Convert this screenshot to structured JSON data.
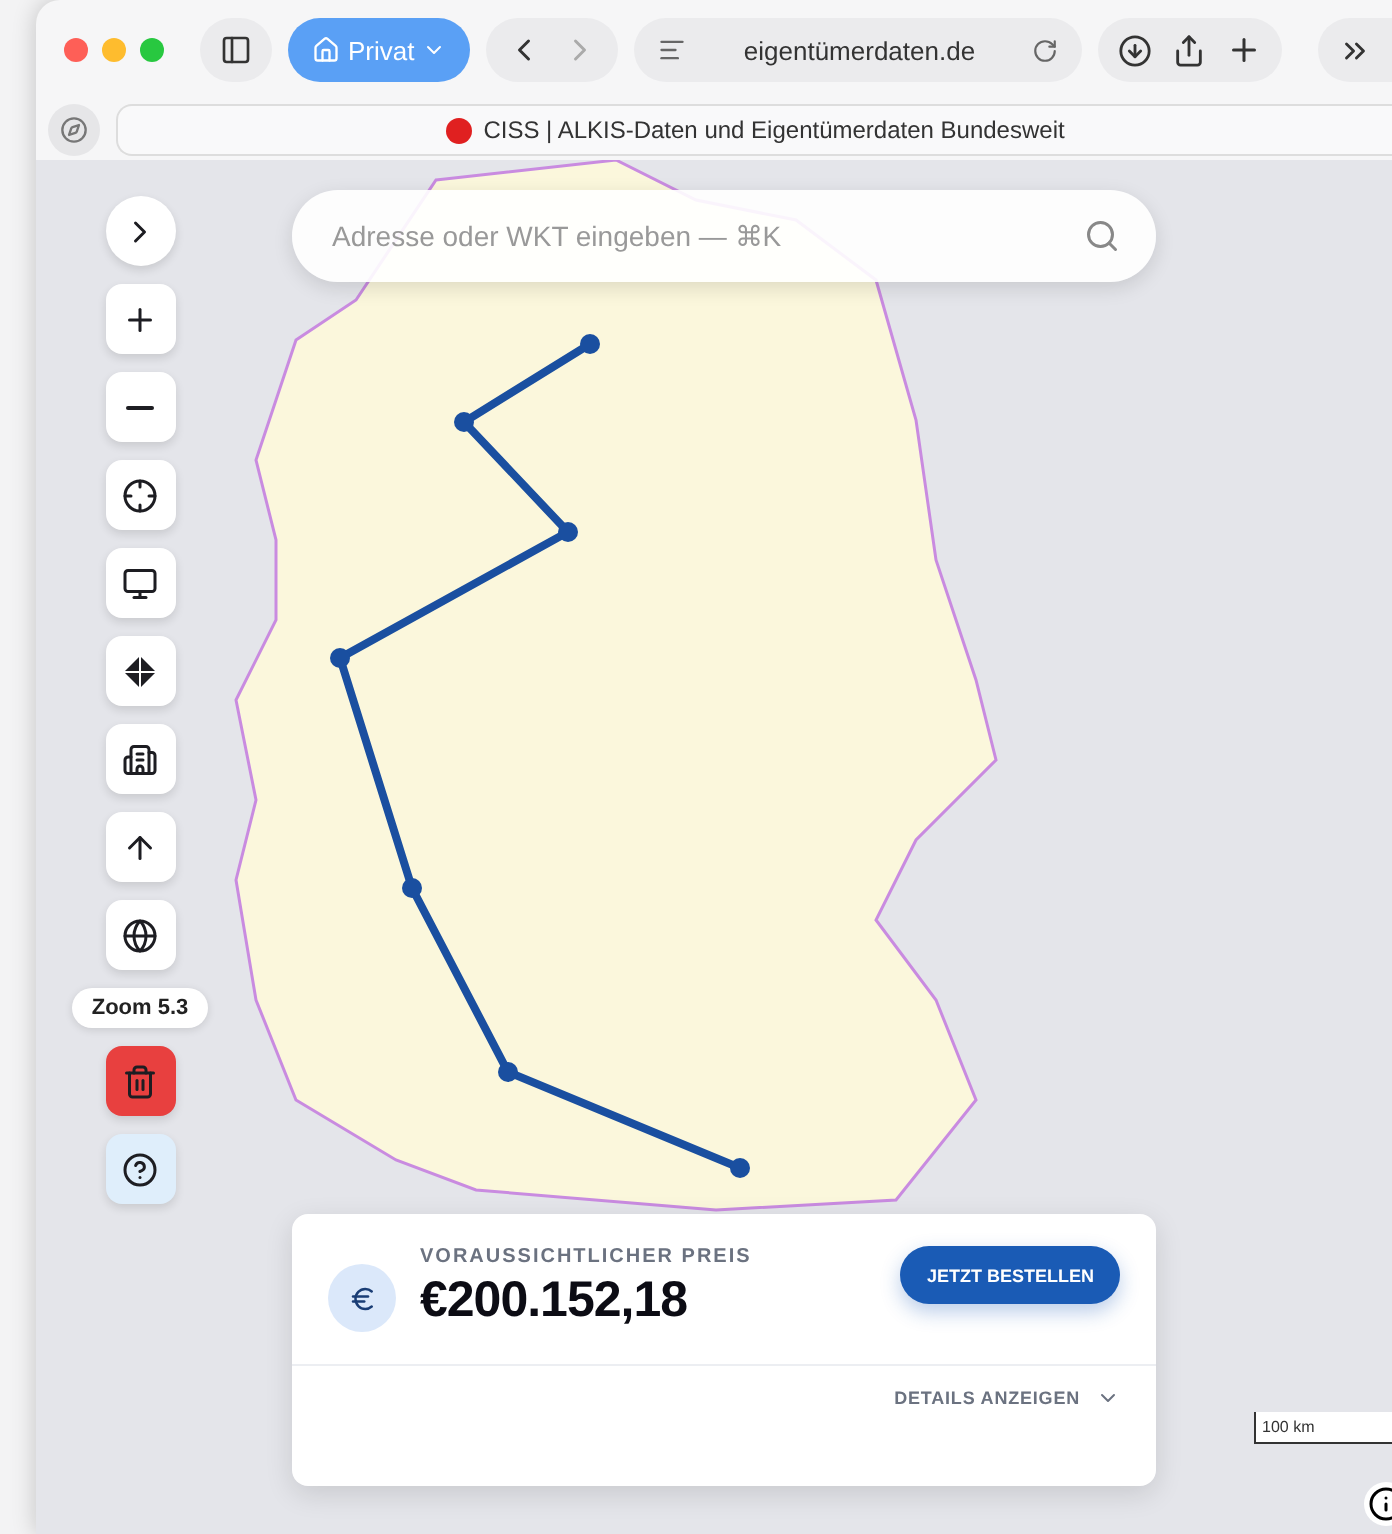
{
  "browser": {
    "profile": "Privat",
    "address": "eigentümerdaten.de",
    "tab_title": "CISS | ALKIS-Daten und Eigentümerdaten Bundesweit"
  },
  "search": {
    "placeholder": "Adresse oder WKT eingeben — ⌘K"
  },
  "map": {
    "zoom_label": "Zoom 5.3",
    "scale": "100 km"
  },
  "price_card": {
    "label": "VORAUSSICHTLICHER PREIS",
    "value": "€200.152,18",
    "order_button": "JETZT BESTELLEN",
    "details_toggle": "DETAILS ANZEIGEN",
    "expanded": false
  }
}
